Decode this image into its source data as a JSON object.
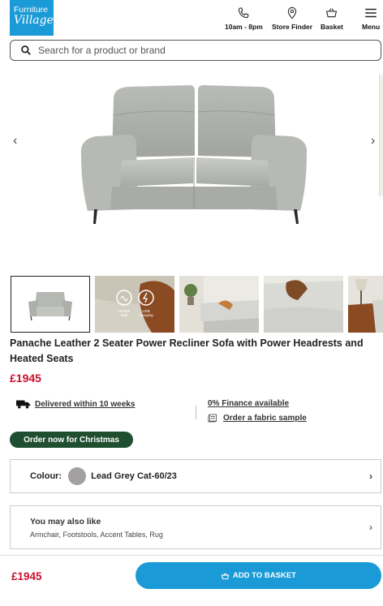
{
  "header": {
    "logo_line1": "Furniture",
    "logo_line2": "Village",
    "hours_label": "10am - 8pm",
    "store_finder_label": "Store Finder",
    "basket_label": "Basket",
    "menu_label": "Menu"
  },
  "search": {
    "placeholder": "Search for a product or brand"
  },
  "gallery": {
    "prev_icon": "chevron-left-icon",
    "next_icon": "chevron-right-icon",
    "thumb_labels": {
      "heated": "Heated seat",
      "usb": "USB charging"
    }
  },
  "product": {
    "title": "Panache Leather 2 Seater Power Recliner Sofa with Power Headrests and Heated Seats",
    "price": "£1945",
    "delivery": "Delivered within 10 weeks",
    "finance": "0% Finance available",
    "fabric_sample": "Order a fabric sample",
    "christmas_badge": "Order now for Christmas"
  },
  "colour": {
    "label": "Colour:",
    "value": "Lead Grey Cat-60/23",
    "swatch": "#a3a09f"
  },
  "also_like": {
    "title": "You may also like",
    "items": "Armchair, Footstools, Accent Tables, Rug"
  },
  "footer": {
    "price": "£1945",
    "add_to_basket": "ADD TO BASKET"
  },
  "colors": {
    "brand_blue": "#1a9ad6",
    "price_red": "#c8102e",
    "christmas_green": "#1f4f2f"
  }
}
